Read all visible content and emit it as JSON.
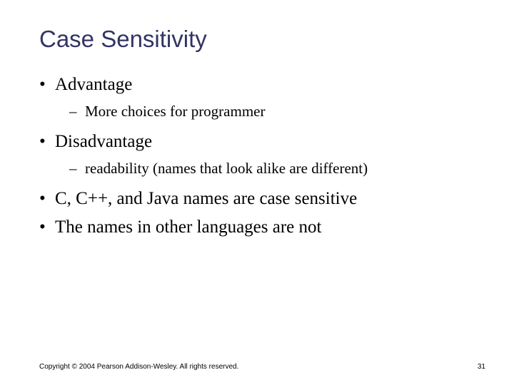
{
  "title": "Case Sensitivity",
  "bullets": {
    "b1": "Advantage",
    "b1_1": "More choices for programmer",
    "b2": "Disadvantage",
    "b2_1": "readability (names that look alike are different)",
    "b3": "C, C++, and Java names are case sensitive",
    "b4": "The names in other languages are not"
  },
  "footer": {
    "copyright": "Copyright © 2004 Pearson Addison-Wesley. All rights reserved.",
    "page": "31"
  }
}
